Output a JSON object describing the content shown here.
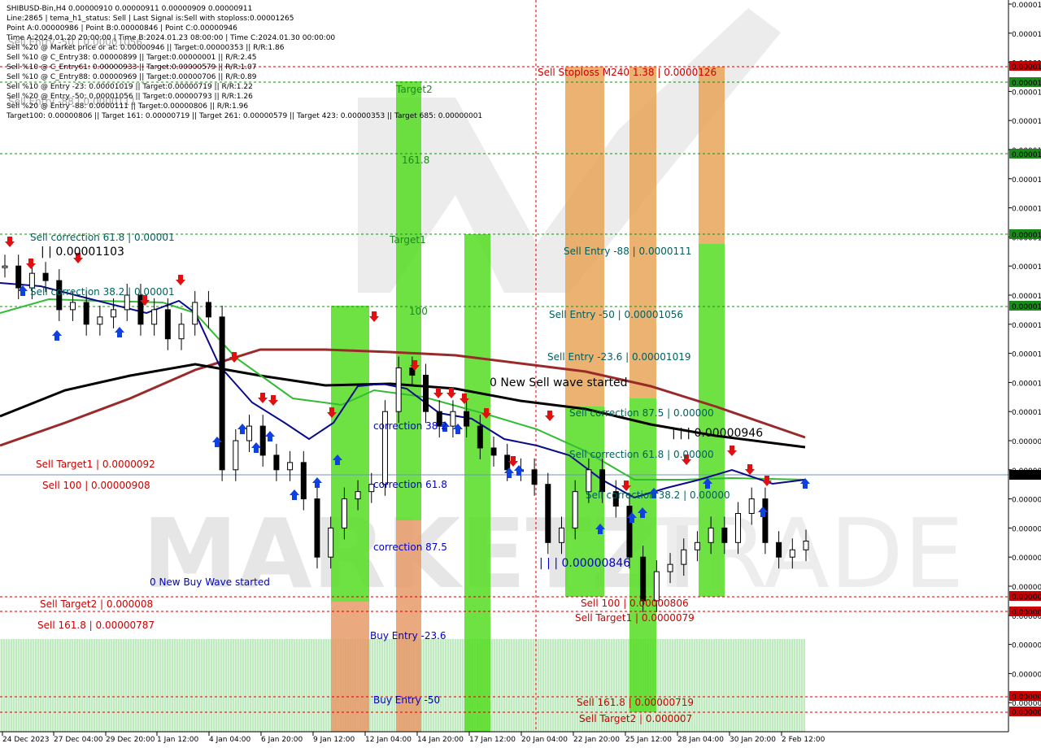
{
  "header": {
    "lines": [
      "SHIBUSD-Bin,H4  0.00000910 0.00000911 0.00000909 0.00000911",
      "Line:2865 | tema_h1_status: Sell | Last Signal is:Sell with stoploss:0.00001265",
      "Point A:0.00000986 | Point B:0.00000846 | Point C:0.00000946",
      "Time A:2024.01.20 20:00:00 | Time B:2024.01.23 08:00:00 | Time C:2024.01.30 00:00:00",
      "Sell %20 @ Market price or at: 0.00000946 || Target:0.00000353 || R/R:1.86",
      "Sell %10 @ C_Entry38: 0.00000899 || Target:0.00000001 || R/R:2.45",
      "Sell %10 @ C_Entry61: 0.00000933 || Target:0.00000579 || R/R:1.07",
      "Sell %10 @ C_Entry88: 0.00000969 || Target:0.00000706 || R/R:0.89",
      "Sell %10 @ Entry -23: 0.00001019 || Target:0.00000719 || R/R:1.22",
      "Sell %20 @ Entry -50: 0.00001056 || Target:0.00000793 || R/R:1.26",
      "Sell %20 @ Entry -88: 0.0000111 || Target:0.00000806 || R/R:1.96",
      "Target100: 0.00000806 || Target 161: 0.00000719 || Target 261: 0.00000579 || Target 423: 0.00000353 || Target 685: 0.00000001"
    ],
    "ghost_lines": [
      "Sell Entry -50 | 0.00001056",
      "Sell Entry -88 | 0.0000111"
    ]
  },
  "watermark": {
    "left": "MARKETZI",
    "right": "TRADE"
  },
  "chart_data": {
    "type": "candlestick",
    "symbol": "SHIBUSD-Bin",
    "timeframe": "H4",
    "x_tick_labels": [
      "24 Dec 2023",
      "27 Dec 04:00",
      "29 Dec 20:00",
      "1 Jan 12:00",
      "4 Jan 04:00",
      "6 Jan 20:00",
      "9 Jan 12:00",
      "12 Jan 04:00",
      "14 Jan 20:00",
      "17 Jan 12:00",
      "20 Jan 04:00",
      "22 Jan 20:00",
      "25 Jan 12:00",
      "28 Jan 04:00",
      "30 Jan 20:00",
      "2 Feb 12:00"
    ],
    "y_axis_labels": [
      "0.00001",
      "0.00001",
      "0.00001",
      "0.00001",
      "0.00001",
      "0.00001",
      "0.00001",
      "0.00001",
      "0.00001",
      "0.00001",
      "0.00001",
      "0.00001",
      "0.00001",
      "0.00001",
      "0.00001",
      "0.00000",
      "0.00000",
      "0.00000",
      "0.00000",
      "0.00000",
      "0.00000",
      "0.00000",
      "0.00000",
      "0.00000",
      "0.00000",
      "0.00000"
    ],
    "y_axis_values": [
      1.28e-05,
      1.26e-05,
      1.24e-05,
      1.22e-05,
      1.2e-05,
      1.18e-05,
      1.16e-05,
      1.14e-05,
      1.12e-05,
      1.1e-05,
      1.08e-05,
      1.06e-05,
      1.04e-05,
      1.02e-05,
      1e-05,
      9.8e-06,
      9.6e-06,
      9.4e-06,
      9.2e-06,
      9e-06,
      8.8e-06,
      8.6e-06,
      8.4e-06,
      8.2e-06,
      8e-06,
      7.8e-06
    ],
    "current_price": 9.11e-06,
    "current_price_label": "0.00000",
    "price_markers": [
      {
        "value": 1.26e-05,
        "label": "0.00001",
        "color": "#cc0000"
      },
      {
        "value": 1.25e-05,
        "label": "0.00001",
        "color": "#1a8a1a"
      },
      {
        "value": 1.2e-05,
        "label": "0.00001",
        "color": "#1a8a1a"
      },
      {
        "value": 1.15e-05,
        "label": "0.00001",
        "color": "#1a8a1a"
      },
      {
        "value": 1.1e-05,
        "label": "0.00001",
        "color": "#1a8a1a"
      },
      {
        "value": 8e-06,
        "label": "0.00000",
        "color": "#cc0000"
      },
      {
        "value": 7.9e-06,
        "label": "0.00000",
        "color": "#cc0000"
      },
      {
        "value": 7.19e-06,
        "label": "0.00000",
        "color": "#cc0000"
      },
      {
        "value": 7.1e-06,
        "label": "0.00000",
        "color": "#cc0000"
      }
    ],
    "levels": [
      {
        "label": "Sell Stoploss M240 1.38 | 0.0000126",
        "value": 1.26e-05,
        "color": "#cc0000"
      },
      {
        "label": "Sell Entry -88 | 0.0000111",
        "value": 1.11e-05,
        "color": "#006060"
      },
      {
        "label": "Sell Entry -50 | 0.00001056",
        "value": 1.056e-05,
        "color": "#006060"
      },
      {
        "label": "Sell Entry -23.6 | 0.00001019",
        "value": 1.019e-05,
        "color": "#006060"
      },
      {
        "label": "Sell correction 87.5 | 0.00000",
        "value": 9.7e-06,
        "color": "#006060"
      },
      {
        "label": "Sell correction 61.8 | 0.00000",
        "value": 9.3e-06,
        "color": "#006060"
      },
      {
        "label": "Sell correction 38.2 | 0.00000",
        "value": 8.95e-06,
        "color": "#006060"
      },
      {
        "label": "Sell 100 | 0.00000806",
        "value": 8.06e-06,
        "color": "#cc0000"
      },
      {
        "label": "Sell Target1 | 0.0000079",
        "value": 7.9e-06,
        "color": "#cc0000"
      },
      {
        "label": "Sell 161.8 | 0.00000719",
        "value": 7.19e-06,
        "color": "#cc0000"
      },
      {
        "label": "Sell Target2 | 0.000007",
        "value": 7e-06,
        "color": "#cc0000"
      },
      {
        "label": "Sell Target1 | 0.0000092",
        "value": 9.2e-06,
        "color": "#cc0000"
      },
      {
        "label": "Sell 100 | 0.00000908",
        "value": 9.08e-06,
        "color": "#cc0000"
      },
      {
        "label": "Sell Target2 | 0.000008",
        "value": 8e-06,
        "color": "#cc0000"
      },
      {
        "label": "Sell 161.8 | 0.00000787",
        "value": 7.87e-06,
        "color": "#cc0000"
      },
      {
        "label": "Sell correction 61.8 | 0.00001",
        "value": 1.12e-05,
        "color": "#006060"
      },
      {
        "label": "Sell correction 38.2 | 0.00001",
        "value": 1.05e-05,
        "color": "#006060"
      },
      {
        "label": "Target2",
        "value": 1.25e-05,
        "color": "#1a8a1a"
      },
      {
        "label": "161.8",
        "value": 1.19e-05,
        "color": "#1a8a1a"
      },
      {
        "label": "Target1",
        "value": 1.13e-05,
        "color": "#1a8a1a"
      },
      {
        "label": "100",
        "value": 1.07e-05,
        "color": "#1a8a1a"
      },
      {
        "label": "correction 38.2",
        "value": 9.6e-06,
        "color": "#0000cc"
      },
      {
        "label": "correction 61.8",
        "value": 9.2e-06,
        "color": "#0000cc"
      },
      {
        "label": "correction 87.5",
        "value": 8.7e-06,
        "color": "#0000cc"
      },
      {
        "label": "Buy Entry -23.6",
        "value": 7.8e-06,
        "color": "#0000cc"
      },
      {
        "label": "Buy Entry -50",
        "value": 7.3e-06,
        "color": "#0000cc"
      },
      {
        "label": "0 New Buy Wave started",
        "value": 8.4e-06,
        "color": "#0000cc"
      },
      {
        "label": "0 New Sell wave started",
        "value": 1e-05,
        "color": "#000000"
      },
      {
        "label": "| | | 0.00000846",
        "value": 8.46e-06,
        "color": "#0000cc"
      },
      {
        "label": "| | | 0.00000946",
        "value": 9.46e-06,
        "color": "#000000"
      },
      {
        "label": "| | 0.00001103",
        "value": 1.103e-05,
        "color": "#000000"
      }
    ],
    "series": [
      {
        "name": "close",
        "color": "#000000",
        "values": [
          1.1e-05,
          1.085e-05,
          1.095e-05,
          1.09e-05,
          1.07e-05,
          1.075e-05,
          1.06e-05,
          1.065e-05,
          1.07e-05,
          1.08e-05,
          1.06e-05,
          1.07e-05,
          1.05e-05,
          1.06e-05,
          1.075e-05,
          1.065e-05,
          9.6e-06,
          9.8e-06,
          9.9e-06,
          9.7e-06,
          9.6e-06,
          9.65e-06,
          9.4e-06,
          9e-06,
          9.2e-06,
          9.4e-06,
          9.45e-06,
          9.5e-06,
          1e-05,
          1.03e-05,
          1.025e-05,
          1e-05,
          9.9e-06,
          1e-05,
          9.9e-06,
          9.75e-06,
          9.7e-06,
          9.6e-06,
          9.6e-06,
          9.5e-06,
          9.1e-06,
          9.2e-06,
          9.45e-06,
          9.6e-06,
          9.45e-06,
          9.35e-06,
          9e-06,
          8.7e-06,
          8.9e-06,
          8.95e-06,
          9.05e-06,
          9.1e-06,
          9.2e-06,
          9.1e-06,
          9.3e-06,
          9.4e-06,
          9.1e-06,
          9e-06,
          9.05e-06,
          9.11e-06
        ]
      }
    ]
  }
}
